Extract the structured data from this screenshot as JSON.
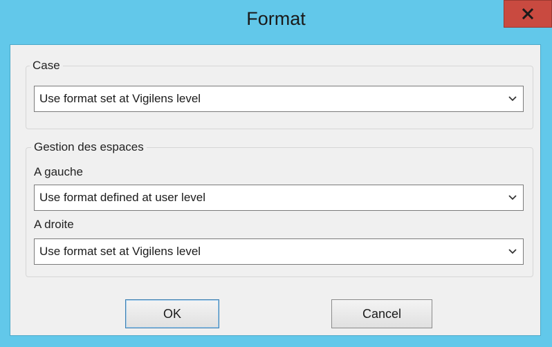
{
  "window": {
    "title": "Format",
    "close_icon": "close-icon"
  },
  "case_group": {
    "label": "Case",
    "select_value": "Use format set at Vigilens level"
  },
  "spacing_group": {
    "label": "Gestion des espaces",
    "left": {
      "label": "A gauche",
      "select_value": "Use format defined at user level"
    },
    "right": {
      "label": "A droite",
      "select_value": "Use format set at Vigilens level"
    }
  },
  "buttons": {
    "ok": "OK",
    "cancel": "Cancel"
  },
  "colors": {
    "titlebar": "#62c8ea",
    "close_button": "#c94a40",
    "dialog_background": "#f0f0f0"
  }
}
